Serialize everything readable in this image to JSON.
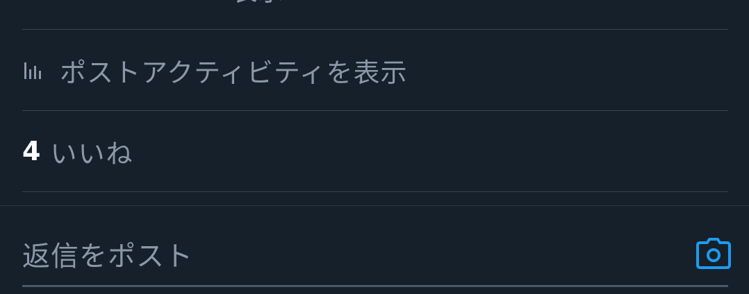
{
  "top_clipped": {
    "text": "ー ー ー ー ー ー 表示"
  },
  "activity": {
    "label": "ポストアクティビティを表示",
    "icon": "bar-chart-icon"
  },
  "likes": {
    "count": "4",
    "label": "いいね"
  },
  "reply": {
    "placeholder": "返信をポスト",
    "icon": "camera-icon"
  },
  "colors": {
    "background": "#15202b",
    "divider": "#38444d",
    "secondary_text": "#8b98a5",
    "primary_text": "#ffffff",
    "accent": "#1d9bf0"
  }
}
